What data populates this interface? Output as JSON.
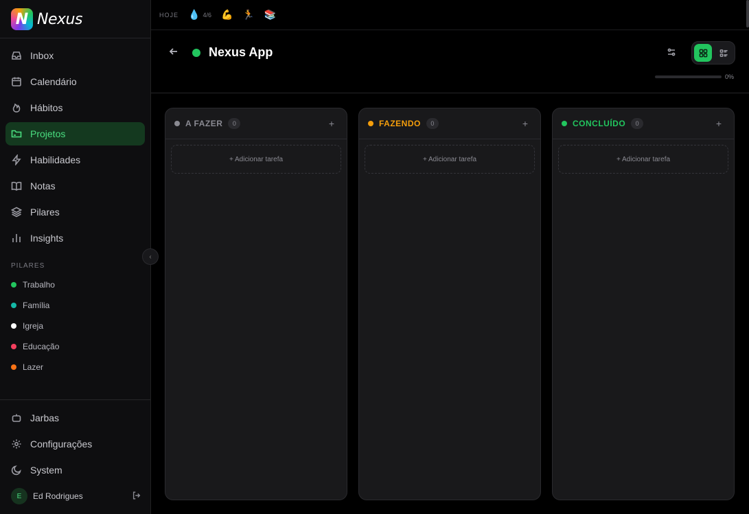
{
  "app": {
    "logo_letter": "N",
    "name": "Nexus"
  },
  "nav": [
    {
      "label": "Inbox",
      "icon": "inbox-icon",
      "active": false
    },
    {
      "label": "Calendário",
      "icon": "calendar-icon",
      "active": false
    },
    {
      "label": "Hábitos",
      "icon": "flame-icon",
      "active": false
    },
    {
      "label": "Projetos",
      "icon": "folder-icon",
      "active": true
    },
    {
      "label": "Habilidades",
      "icon": "bolt-icon",
      "active": false
    },
    {
      "label": "Notas",
      "icon": "book-icon",
      "active": false
    },
    {
      "label": "Pilares",
      "icon": "layers-icon",
      "active": false
    },
    {
      "label": "Insights",
      "icon": "bar-chart-icon",
      "active": false
    }
  ],
  "pilares": {
    "title": "PILARES",
    "items": [
      {
        "label": "Trabalho",
        "color": "#22c55e"
      },
      {
        "label": "Família",
        "color": "#14b8a6"
      },
      {
        "label": "Igreja",
        "color": "#ffffff"
      },
      {
        "label": "Educação",
        "color": "#f43f5e"
      },
      {
        "label": "Lazer",
        "color": "#f97316"
      }
    ]
  },
  "bottom_nav": [
    {
      "label": "Jarbas",
      "icon": "bot-icon"
    },
    {
      "label": "Configurações",
      "icon": "gear-icon"
    },
    {
      "label": "System",
      "icon": "moon-icon"
    }
  ],
  "user": {
    "initial": "E",
    "name": "Ed Rodrigues"
  },
  "topbar": {
    "today_label": "HOJE",
    "habits": [
      {
        "glyph": "💧",
        "value": "4/6",
        "icon": "water-drop-icon"
      },
      {
        "glyph": "💪",
        "value": "",
        "icon": "flexed-biceps-icon"
      },
      {
        "glyph": "🏃",
        "value": "",
        "icon": "runner-icon"
      },
      {
        "glyph": "📚",
        "value": "",
        "icon": "books-icon"
      }
    ]
  },
  "project": {
    "title": "Nexus App",
    "color": "#22c55e",
    "progress_percent": 0,
    "progress_label": "0%",
    "view_mode": "board"
  },
  "columns": [
    {
      "title": "A FAZER",
      "color": "#8a8a92",
      "count": "0",
      "add_label": "+ Adicionar tarefa"
    },
    {
      "title": "FAZENDO",
      "color": "#f59e0b",
      "count": "0",
      "add_label": "+ Adicionar tarefa"
    },
    {
      "title": "CONCLUÍDO",
      "color": "#22c55e",
      "count": "0",
      "add_label": "+ Adicionar tarefa"
    }
  ]
}
